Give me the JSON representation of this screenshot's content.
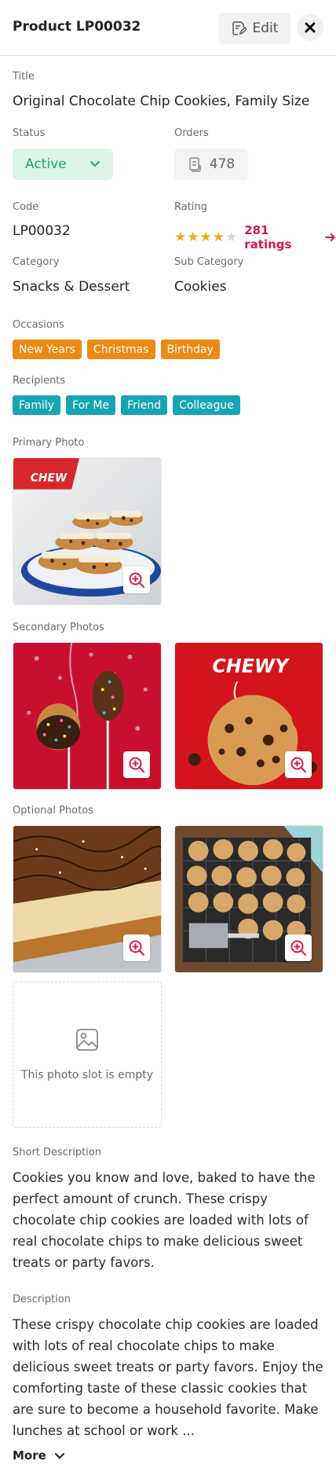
{
  "header": {
    "title": "Product LP00032",
    "edit_label": "Edit"
  },
  "fields": {
    "title_label": "Title",
    "title_value": "Original Chocolate Chip Cookies, Family Size",
    "status_label": "Status",
    "status_value": "Active",
    "orders_label": "Orders",
    "orders_value": "478",
    "code_label": "Code",
    "code_value": "LP00032",
    "rating_label": "Rating",
    "rating_stars": 4,
    "rating_max": 5,
    "ratings_link": "281 ratings",
    "category_label": "Category",
    "category_value": "Snacks & Dessert",
    "subcategory_label": "Sub Category",
    "subcategory_value": "Cookies"
  },
  "occasions": {
    "label": "Occasions",
    "items": [
      "New Years",
      "Christmas",
      "Birthday"
    ]
  },
  "recipients": {
    "label": "Recipients",
    "items": [
      "Family",
      "For Me",
      "Friend",
      "Colleague"
    ]
  },
  "photos": {
    "primary_label": "Primary Photo",
    "secondary_label": "Secondary Photos",
    "optional_label": "Optional Photos",
    "empty_slot_text": "This photo slot is empty"
  },
  "short_description": {
    "label": "Short Description",
    "text": "Cookies you know and love, baked to have the perfect amount of crunch. These crispy chocolate chip cookies are loaded with lots of real chocolate chips to make delicious sweet treats or party favors."
  },
  "description": {
    "label": "Description",
    "text": "These crispy chocolate chip cookies are loaded with lots of real chocolate chips to make delicious sweet treats or party favors. Enjoy the comforting taste of these classic cookies that are sure to become a household favorite. Make lunches at school or work ...",
    "more_label": "More"
  },
  "colors": {
    "accent": "#d6174d",
    "status_bg": "#dbf6e8",
    "status_text": "#21a662",
    "star": "#f2a81d",
    "tag_orange": "#ec8a12",
    "tag_teal": "#17a5b6"
  },
  "icons": {
    "edit": "edit-note-icon",
    "close": "close-x-icon",
    "chevron": "chevron-down-icon",
    "orders": "receipt-icon",
    "arrow": "arrow-right-icon",
    "zoom": "zoom-in-icon",
    "image": "image-placeholder-icon"
  }
}
